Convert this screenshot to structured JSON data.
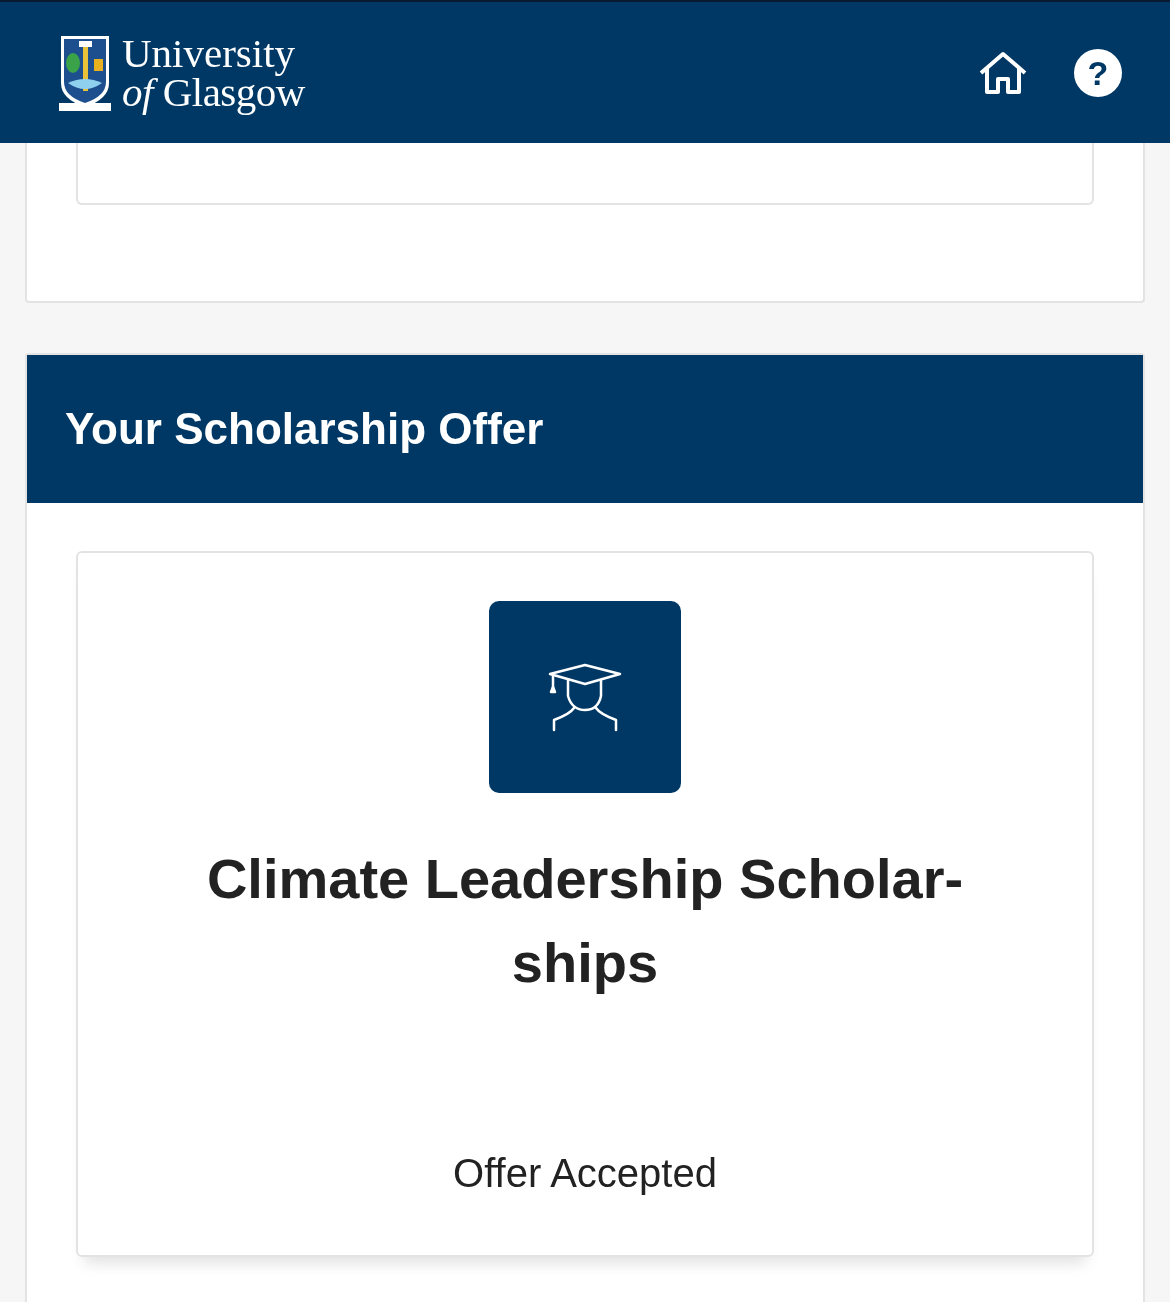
{
  "header": {
    "logo_line_1": "University",
    "logo_line_2": "*of* Glasgow",
    "help_symbol": "?"
  },
  "offer_panel": {
    "title": "Your Scholarship Offer",
    "scholarship": {
      "name": "Climate Leadership Scholar-ships",
      "status": "Offer Accepted"
    }
  }
}
